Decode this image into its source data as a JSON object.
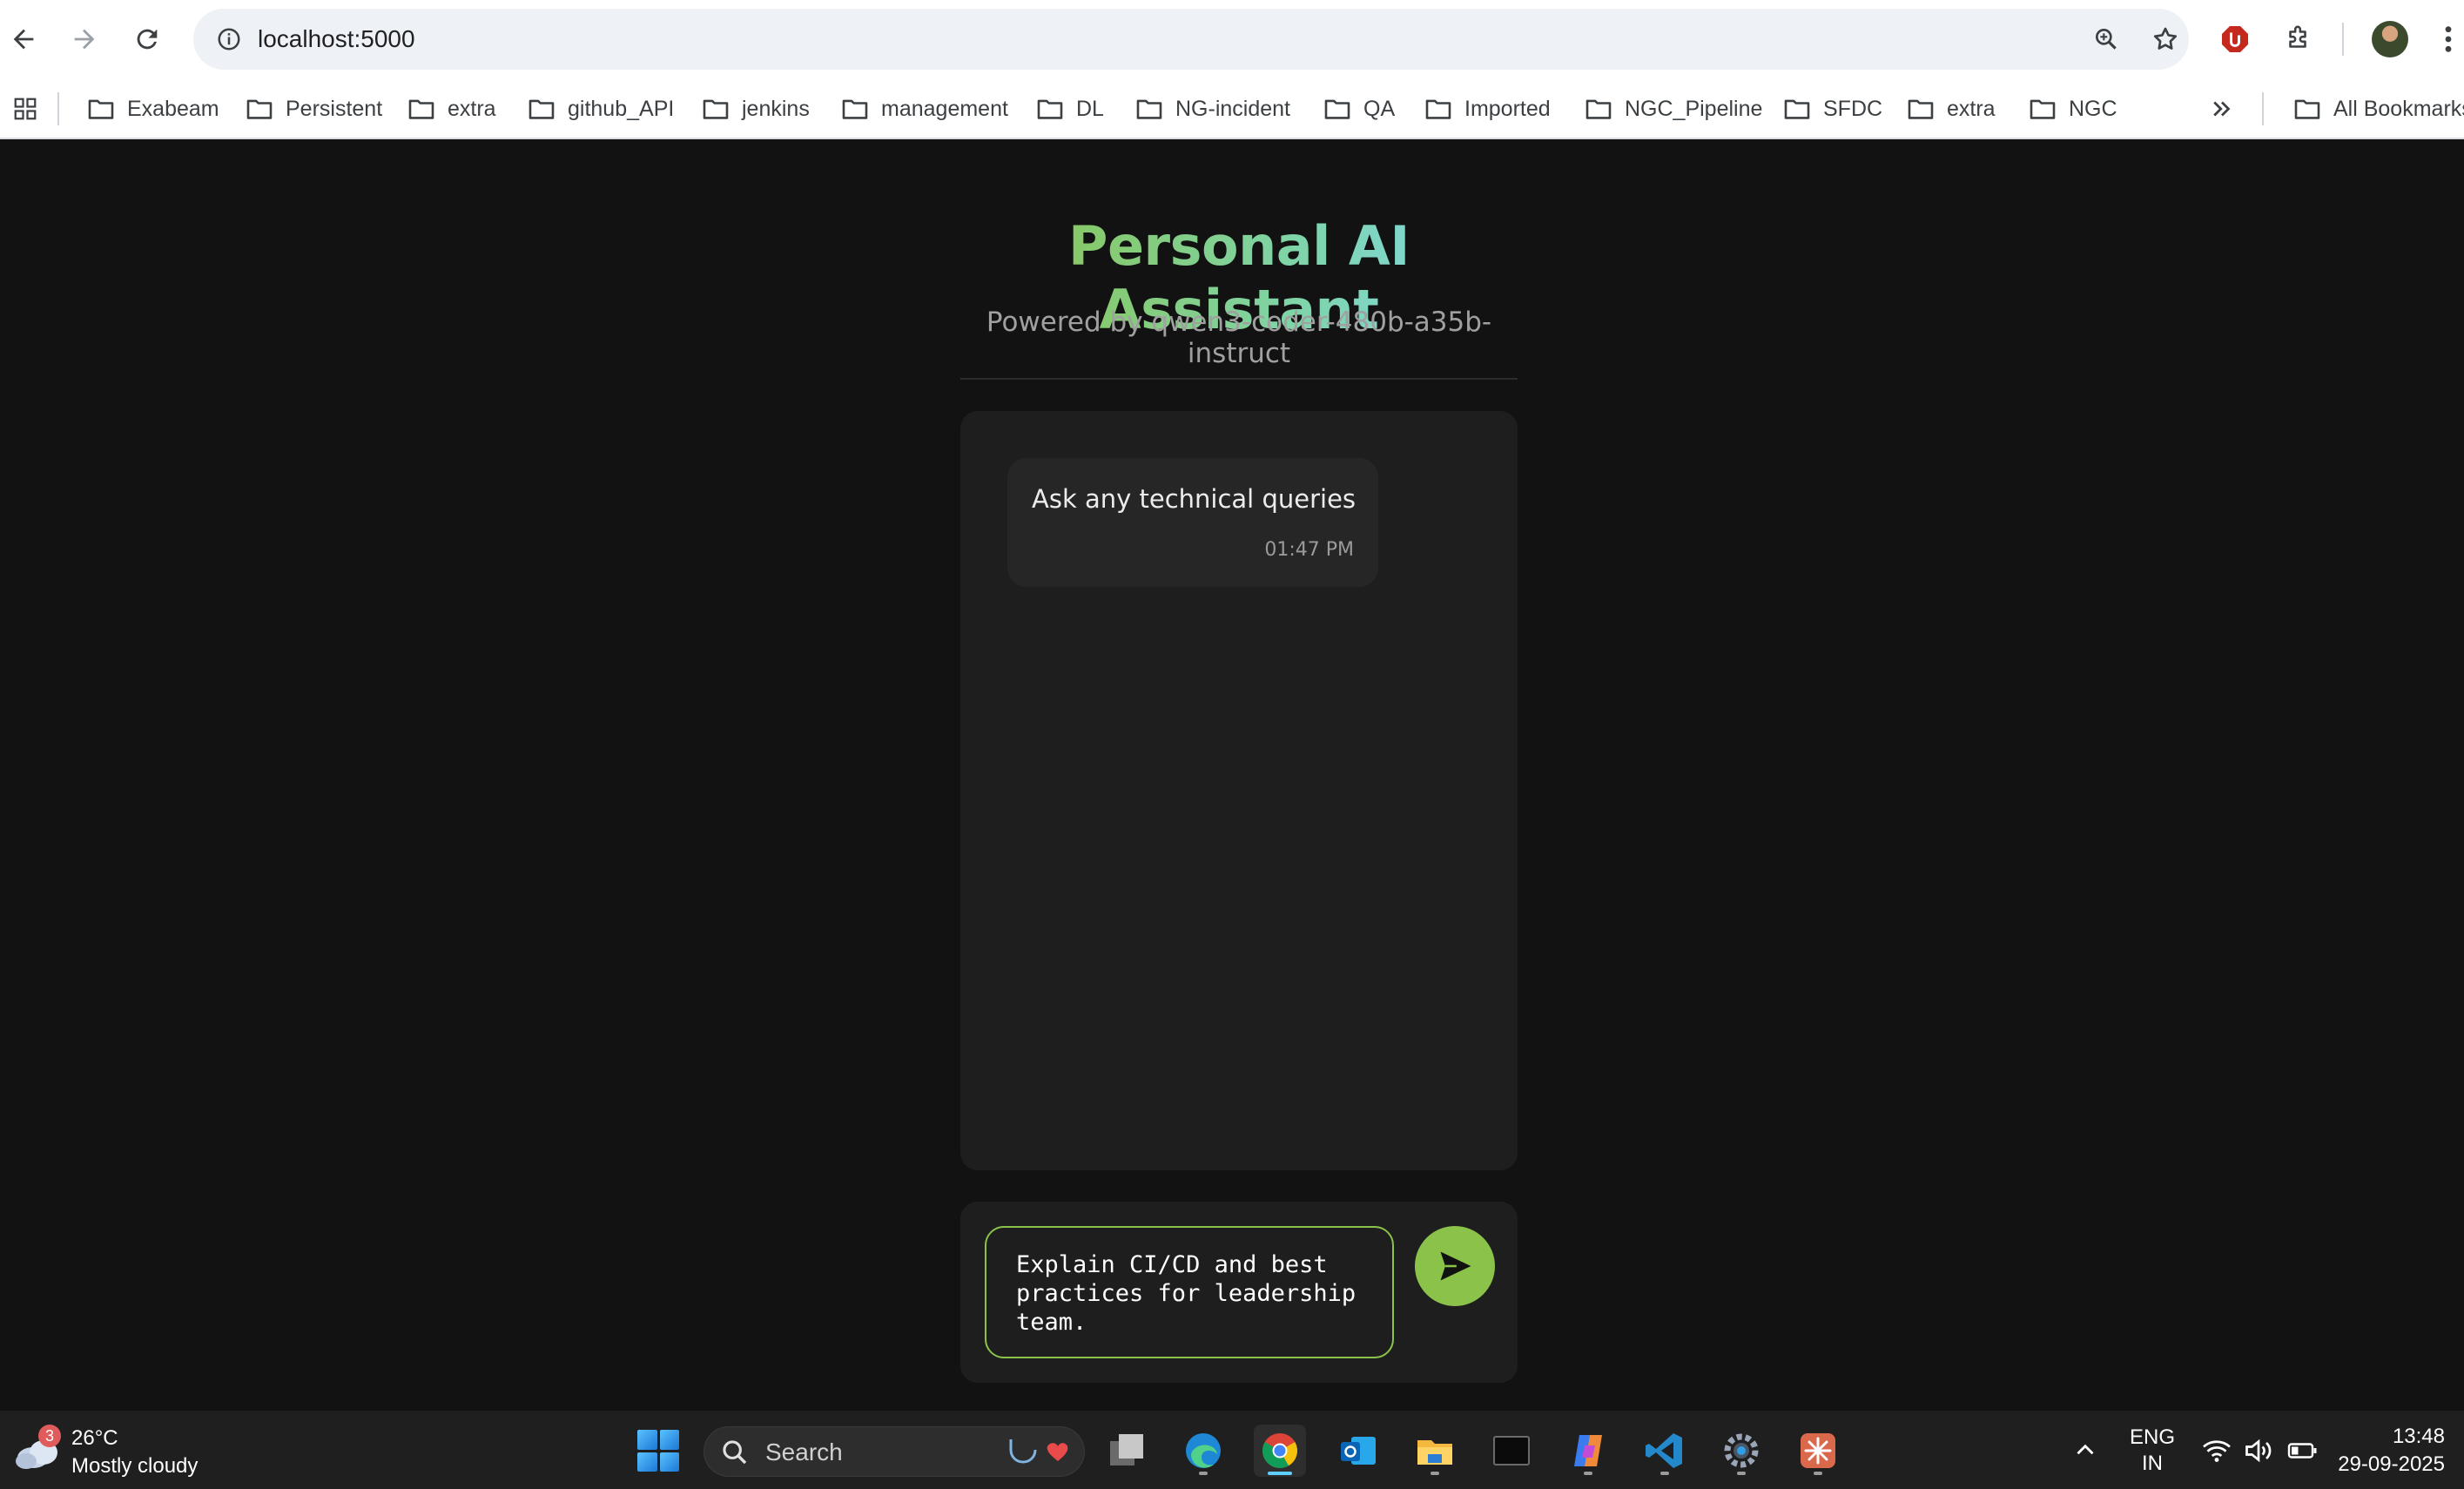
{
  "browser": {
    "url": "localhost:5000",
    "bookmarks": [
      "Exabeam",
      "Persistent",
      "extra",
      "github_API",
      "jenkins",
      "management",
      "DL",
      "NG-incident",
      "QA",
      "Imported",
      "NGC_Pipeline",
      "SFDC",
      "extra",
      "NGC"
    ],
    "all_bookmarks_label": "All Bookmarks",
    "icons": [
      "back-icon",
      "forward-icon",
      "reload-icon",
      "site-info-icon",
      "zoom-icon",
      "bookmark-star-icon",
      "extension-shield-icon",
      "extensions-puzzle-icon",
      "profile-avatar",
      "menu-kebab-icon",
      "apps-grid-icon",
      "folder-icon",
      "chevron-double-right-icon"
    ]
  },
  "app": {
    "title": "Personal AI Assistant",
    "subtitle": "Powered by qwen3-coder-480b-a35b-instruct",
    "messages": [
      {
        "role": "assistant",
        "text": "Ask any technical queries",
        "time": "01:47 PM"
      }
    ],
    "input_value": "Explain CI/CD and best practices for leadership team.",
    "send_icon": "send-icon",
    "colors": {
      "accent": "#8bc34a",
      "title_gradient_end": "#7fd8ee",
      "background": "#121212",
      "panel": "#1e1e1e",
      "bubble": "#262626"
    }
  },
  "taskbar": {
    "weather_temp": "26°C",
    "weather_desc": "Mostly cloudy",
    "weather_badge": "3",
    "search_label": "Search",
    "language_line1": "ENG",
    "language_line2": "IN",
    "time": "13:48",
    "date": "29-09-2025",
    "apps": [
      "windows-start-icon",
      "task-view-icon",
      "edge-icon",
      "chrome-icon",
      "outlook-icon",
      "file-explorer-icon",
      "terminal-icon",
      "copilot-icon",
      "vscode-icon",
      "settings-gear-icon",
      "claude-icon"
    ]
  }
}
